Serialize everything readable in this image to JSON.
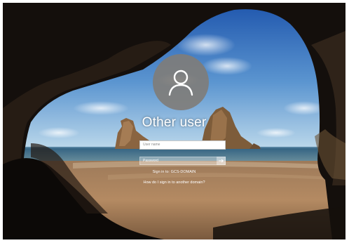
{
  "login": {
    "user_display_name": "Other user",
    "username_placeholder": "User name",
    "password_placeholder": "Password",
    "sign_in_to": "Sign in to: GCS-DOMAIN",
    "other_domain_link": "How do I sign in to another domain?"
  },
  "icons": {
    "avatar": "user-silhouette-icon",
    "submit": "arrow-right-icon"
  },
  "colors": {
    "sky_top": "#2a62b6",
    "sky_bottom": "#a9cde8",
    "sea": "#3c6a8a",
    "sand": "#b48a62",
    "cave": "#120e0b",
    "avatar_bg": "#807c78"
  }
}
